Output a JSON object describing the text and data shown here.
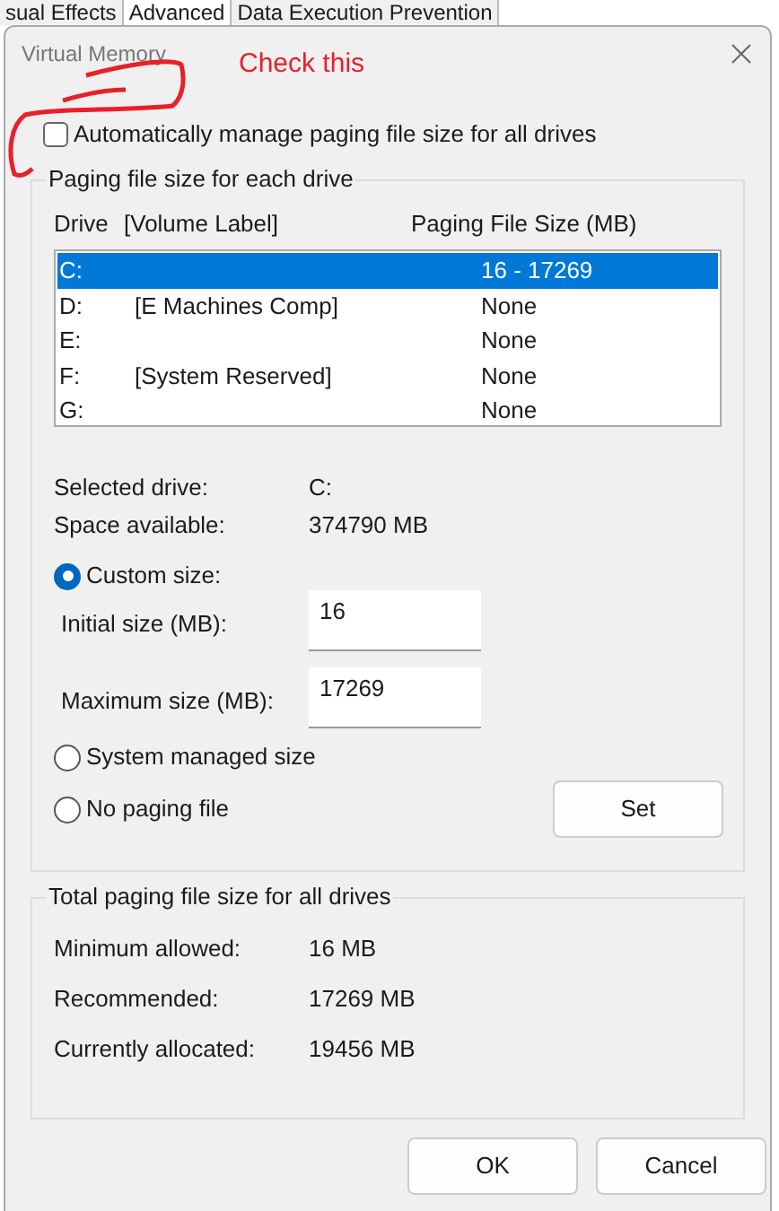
{
  "background_tabs": [
    {
      "label": "sual Effects",
      "selected": false
    },
    {
      "label": "Advanced",
      "selected": true
    },
    {
      "label": "Data Execution Prevention",
      "selected": false
    }
  ],
  "window": {
    "title": "Virtual Memory"
  },
  "annotation": {
    "text": "Check this"
  },
  "auto_manage": {
    "label": "Automatically manage paging file size for all drives",
    "checked": false
  },
  "drives_group": {
    "title": "Paging file size for each drive",
    "columns": [
      "Drive",
      "[Volume Label]",
      "Paging File Size (MB)"
    ],
    "rows": [
      {
        "drive": "C:",
        "label": "",
        "size": "16 - 17269",
        "selected": true
      },
      {
        "drive": "D:",
        "label": "[E Machines Comp]",
        "size": "None",
        "selected": false
      },
      {
        "drive": "E:",
        "label": "",
        "size": "None",
        "selected": false
      },
      {
        "drive": "F:",
        "label": "[System Reserved]",
        "size": "None",
        "selected": false
      },
      {
        "drive": "G:",
        "label": "",
        "size": "None",
        "selected": false
      }
    ],
    "info": [
      {
        "label": "Selected drive:",
        "value": "C:"
      },
      {
        "label": "Space available:",
        "value": "374790 MB"
      }
    ],
    "options": [
      {
        "label": "Custom size:",
        "selected": true
      },
      {
        "label": "System managed size",
        "selected": false
      },
      {
        "label": "No paging file",
        "selected": false
      }
    ],
    "fields": [
      {
        "label": "Initial size (MB):",
        "value": "16"
      },
      {
        "label": "Maximum size (MB):",
        "value": "17269"
      }
    ],
    "set_button": "Set"
  },
  "totals_group": {
    "title": "Total paging file size for all drives",
    "rows": [
      {
        "label": "Minimum allowed:",
        "value": "16 MB"
      },
      {
        "label": "Recommended:",
        "value": "17269 MB"
      },
      {
        "label": "Currently allocated:",
        "value": "19456 MB"
      }
    ]
  },
  "buttons": [
    "OK",
    "Cancel"
  ]
}
